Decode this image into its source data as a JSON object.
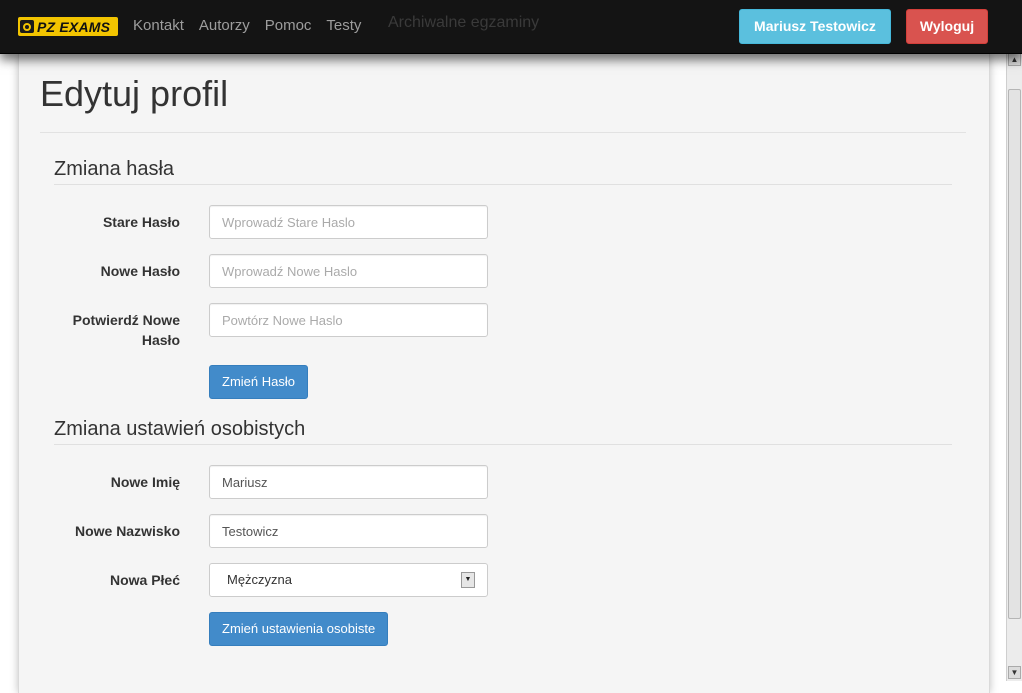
{
  "navbar": {
    "brand_text": "PZ EXAMS",
    "ghost_links": [
      "Archiwalne egzaminy"
    ],
    "links": [
      "Kontakt",
      "Autorzy",
      "Pomoc",
      "Testy"
    ],
    "user_button": "Mariusz Testowicz",
    "logout_button": "Wyloguj"
  },
  "page": {
    "title": "Edytuj profil"
  },
  "password_section": {
    "title": "Zmiana hasła",
    "old_label": "Stare Hasło",
    "old_placeholder": "Wprowadź Stare Haslo",
    "new_label": "Nowe Hasło",
    "new_placeholder": "Wprowadź Nowe Haslo",
    "confirm_label_line1": "Potwierdź Nowe",
    "confirm_label_line2": "Hasło",
    "confirm_placeholder": "Powtórz Nowe Haslo",
    "submit": "Zmień Hasło"
  },
  "personal_section": {
    "title": "Zmiana ustawień osobistych",
    "firstname_label": "Nowe Imię",
    "firstname_value": "Mariusz",
    "lastname_label": "Nowe Nazwisko",
    "lastname_value": "Testowicz",
    "gender_label": "Nowa Płeć",
    "gender_value": "Mężczyzna",
    "submit": "Zmień ustawienia osobiste"
  },
  "colors": {
    "navbar_bg": "#141414",
    "info_button": "#5bc0de",
    "danger_button": "#d9534f",
    "primary_button": "#428bca",
    "panel_bg": "#f5f5f5"
  }
}
